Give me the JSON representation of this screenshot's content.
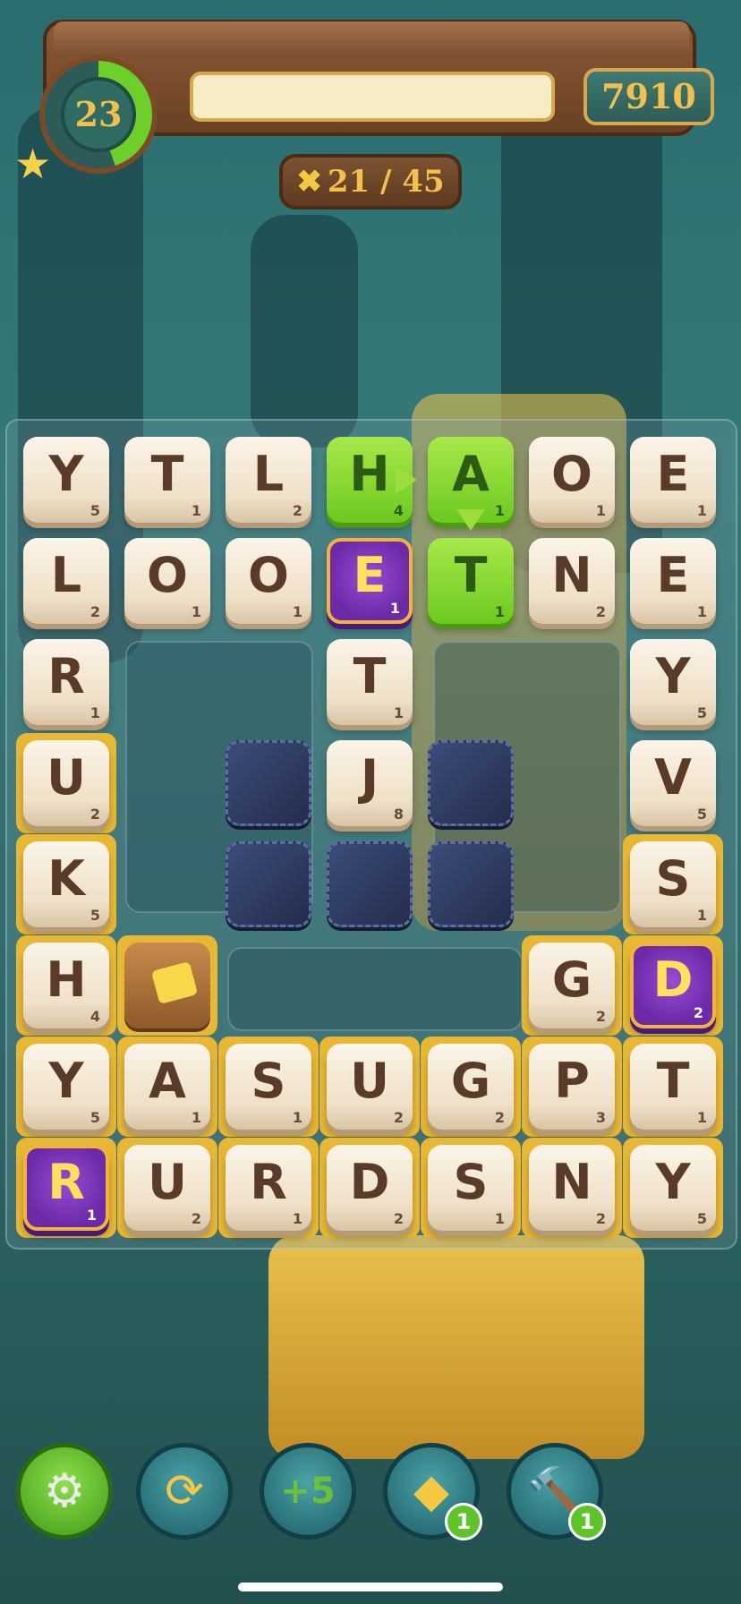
{
  "header": {
    "level": "23",
    "score": "7910",
    "moves": "21 / 45",
    "progress_fraction": 0.0,
    "level_ring_fraction": 0.45
  },
  "board": {
    "rows": [
      [
        {
          "l": "Y",
          "s": "5"
        },
        {
          "l": "T",
          "s": "1"
        },
        {
          "l": "L",
          "s": "2"
        },
        {
          "l": "H",
          "s": "4",
          "t": "green"
        },
        {
          "l": "A",
          "s": "1",
          "t": "green"
        },
        {
          "l": "O",
          "s": "1"
        },
        {
          "l": "E",
          "s": "1"
        }
      ],
      [
        {
          "l": "L",
          "s": "2"
        },
        {
          "l": "O",
          "s": "1"
        },
        {
          "l": "O",
          "s": "1"
        },
        {
          "l": "E",
          "s": "1",
          "t": "purple"
        },
        {
          "l": "T",
          "s": "1",
          "t": "green"
        },
        {
          "l": "N",
          "s": "2"
        },
        {
          "l": "E",
          "s": "1"
        }
      ],
      [
        {
          "l": "R",
          "s": "1"
        },
        null,
        null,
        {
          "l": "T",
          "s": "1"
        },
        null,
        null,
        {
          "l": "Y",
          "s": "5"
        }
      ],
      [
        {
          "l": "U",
          "s": "2",
          "g": true
        },
        null,
        {
          "t": "rock"
        },
        {
          "l": "J",
          "s": "8"
        },
        {
          "t": "rock"
        },
        null,
        {
          "l": "V",
          "s": "5"
        }
      ],
      [
        {
          "l": "K",
          "s": "5",
          "g": true
        },
        null,
        {
          "t": "rock"
        },
        {
          "t": "rock"
        },
        {
          "t": "rock"
        },
        null,
        {
          "l": "S",
          "s": "1",
          "g": true
        }
      ],
      [
        {
          "l": "H",
          "s": "4",
          "g": true
        },
        {
          "t": "trap",
          "g": true
        },
        null,
        null,
        null,
        {
          "l": "G",
          "s": "2",
          "g": true
        },
        {
          "l": "D",
          "s": "2",
          "t": "purple",
          "g": true
        }
      ],
      [
        {
          "l": "Y",
          "s": "5",
          "g": true
        },
        {
          "l": "A",
          "s": "1",
          "g": true
        },
        {
          "l": "S",
          "s": "1",
          "g": true
        },
        {
          "l": "U",
          "s": "2",
          "g": true
        },
        {
          "l": "G",
          "s": "2",
          "g": true
        },
        {
          "l": "P",
          "s": "3",
          "g": true
        },
        {
          "l": "T",
          "s": "1",
          "g": true
        }
      ],
      [
        {
          "l": "R",
          "s": "1",
          "t": "purple",
          "g": true
        },
        {
          "l": "U",
          "s": "2",
          "g": true
        },
        {
          "l": "R",
          "s": "1",
          "g": true
        },
        {
          "l": "D",
          "s": "2",
          "g": true
        },
        {
          "l": "S",
          "s": "1",
          "g": true
        },
        {
          "l": "N",
          "s": "2",
          "g": true
        },
        {
          "l": "Y",
          "s": "5",
          "g": true
        }
      ]
    ]
  },
  "powerups": [
    {
      "name": "settings-button",
      "icon": "gear-icon",
      "glyph": "⚙",
      "badge": null
    },
    {
      "name": "shuffle-button",
      "icon": "shuffle-icon",
      "glyph": "⟳",
      "badge": null
    },
    {
      "name": "plus-five-button",
      "icon": "plus-five-moves-icon",
      "glyph": "+5",
      "badge": null
    },
    {
      "name": "special-tile-button",
      "icon": "special-tile-icon",
      "glyph": "◆",
      "badge": "1"
    },
    {
      "name": "hammer-button",
      "icon": "hammer-icon",
      "glyph": "🔨",
      "badge": "1"
    }
  ],
  "colors": {
    "tile": "#efe0c9",
    "green_tile": "#6cc91e",
    "purple_tile": "#6c2aa8",
    "gold_highlight": "#e8b733",
    "accent_text": "#f4c04d"
  }
}
